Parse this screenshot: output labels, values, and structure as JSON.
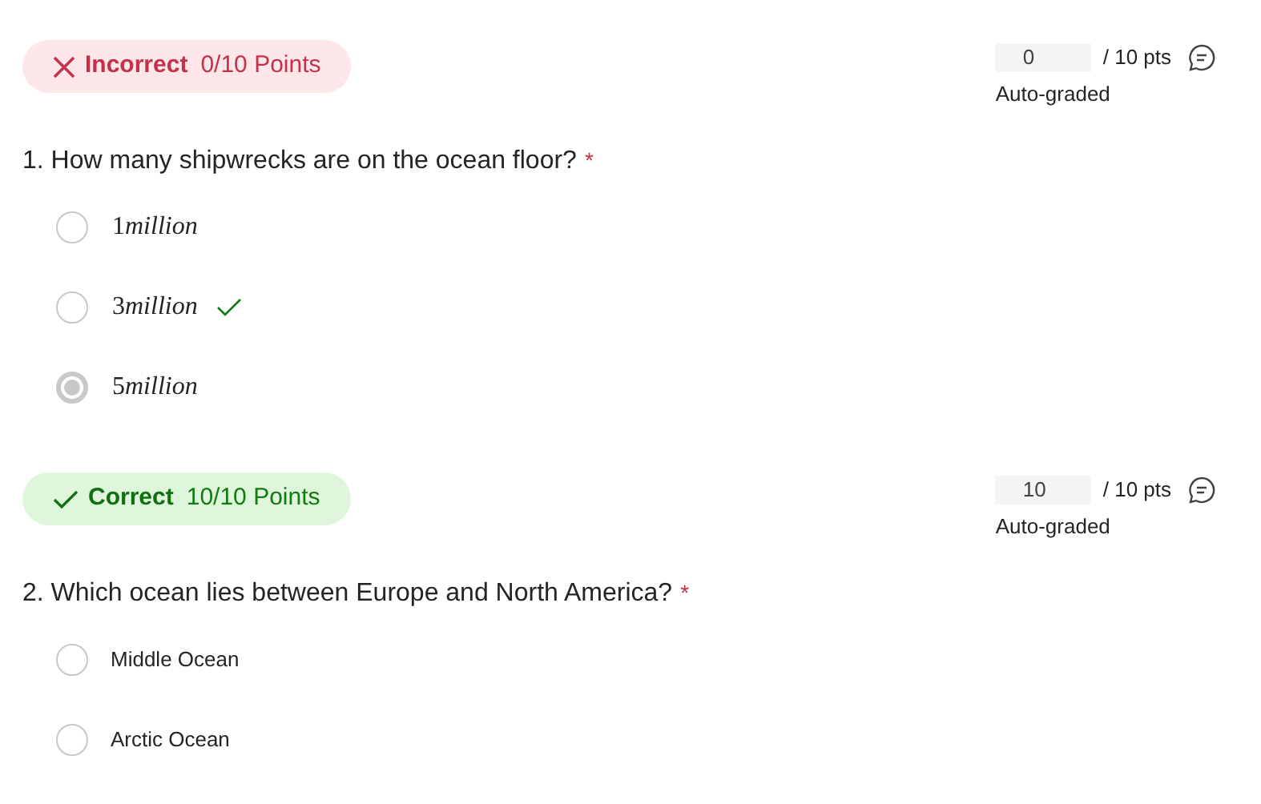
{
  "questions": [
    {
      "result": {
        "kind": "incorrect",
        "label": "Incorrect",
        "points": "0/10 Points"
      },
      "score": {
        "value": "0",
        "max": "/ 10 pts",
        "note": "Auto-graded"
      },
      "question": "1. How many shipwrecks are on the ocean floor?",
      "required_mark": "*",
      "options": [
        {
          "kind": "math",
          "number": "1",
          "unit": "million",
          "selected": false,
          "correct": false
        },
        {
          "kind": "math",
          "number": "3",
          "unit": "million",
          "selected": false,
          "correct": true
        },
        {
          "kind": "math",
          "number": "5",
          "unit": "million",
          "selected": true,
          "correct": false
        }
      ]
    },
    {
      "result": {
        "kind": "correct",
        "label": "Correct",
        "points": "10/10 Points"
      },
      "score": {
        "value": "10",
        "max": "/ 10 pts",
        "note": "Auto-graded"
      },
      "question": "2. Which ocean lies between Europe and North America?",
      "required_mark": "*",
      "options": [
        {
          "kind": "plain",
          "label": "Middle Ocean",
          "selected": false,
          "correct": false
        },
        {
          "kind": "plain",
          "label": "Arctic Ocean",
          "selected": false,
          "correct": false
        }
      ]
    }
  ]
}
